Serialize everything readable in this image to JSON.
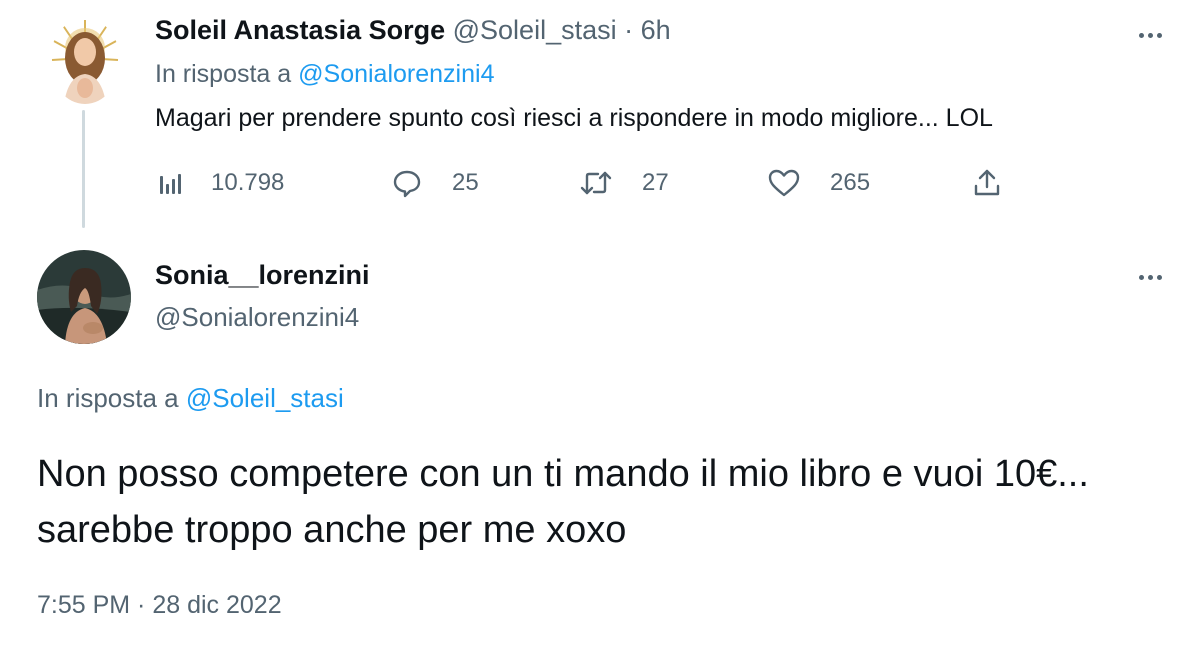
{
  "reply_tweet": {
    "author_name": "Soleil Anastasia Sorge",
    "author_handle": "@Soleil_stasi",
    "separator": " · ",
    "time": "6h",
    "reply_prefix": "In risposta a ",
    "reply_to": "@Sonialorenzini4",
    "text": "Magari per prendere spunto così riesci a rispondere in modo migliore... LOL",
    "actions": {
      "views": "10.798",
      "replies": "25",
      "retweets": "27",
      "likes": "265"
    }
  },
  "main_tweet": {
    "author_name": "Sonia__lorenzini",
    "author_handle": "@Sonialorenzini4",
    "reply_prefix": "In risposta a ",
    "reply_to": "@Soleil_stasi",
    "text": "Non posso competere con un ti mando il mio libro e vuoi 10€... sarebbe troppo anche per me xoxo",
    "timestamp": "7:55 PM · 28 dic 2022"
  },
  "colors": {
    "text": "#0f1419",
    "muted": "#536471",
    "link": "#1d9bf0",
    "thread_line": "#cfd9de"
  },
  "icons": [
    "views-icon",
    "reply-icon",
    "retweet-icon",
    "like-icon",
    "share-icon",
    "more-icon"
  ]
}
